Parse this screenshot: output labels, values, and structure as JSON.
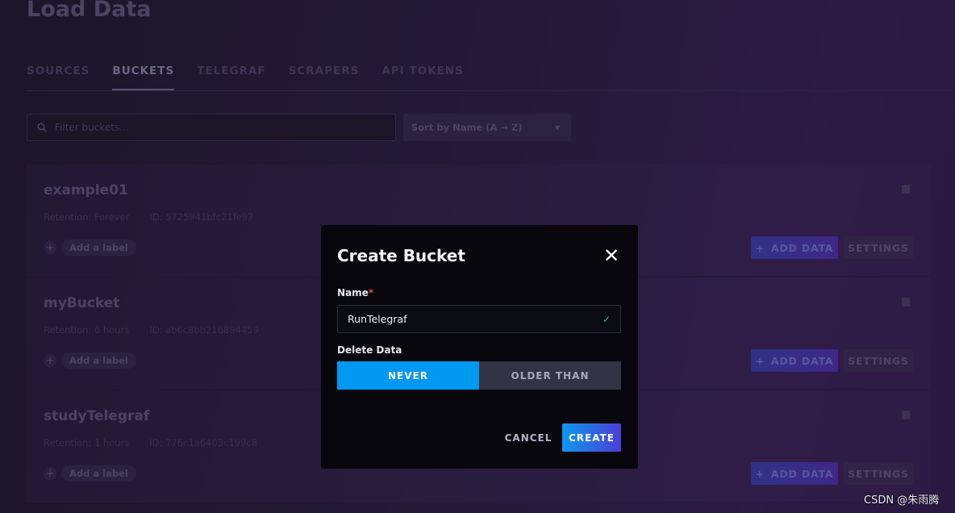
{
  "page": {
    "title": "Load Data"
  },
  "tabs": [
    {
      "label": "SOURCES"
    },
    {
      "label": "BUCKETS",
      "active": true
    },
    {
      "label": "TELEGRAF"
    },
    {
      "label": "SCRAPERS"
    },
    {
      "label": "API TOKENS"
    }
  ],
  "filter": {
    "placeholder": "Filter buckets...",
    "sort": "Sort by Name (A → Z)"
  },
  "buckets": [
    {
      "name": "example01",
      "retention": "Retention: Forever",
      "id": "ID: 5725941bfc21fe97",
      "add_label": "Add a label",
      "add_data": "ADD DATA",
      "settings": "SETTINGS"
    },
    {
      "name": "myBucket",
      "retention": "Retention: 6 hours",
      "id": "ID: ab6c8bb216894459",
      "add_label": "Add a label",
      "add_data": "ADD DATA",
      "settings": "SETTINGS"
    },
    {
      "name": "studyTelegraf",
      "retention": "Retention: 1 hours",
      "id": "ID: 776c1a6403c199c8",
      "add_label": "Add a label",
      "add_data": "ADD DATA",
      "settings": "SETTINGS"
    }
  ],
  "modal": {
    "title": "Create Bucket",
    "name_label": "Name",
    "required_mark": "*",
    "name_value": "RunTelegraf",
    "delete_label": "Delete Data",
    "options": [
      "NEVER",
      "OLDER THAN"
    ],
    "selected": "NEVER",
    "cancel": "CANCEL",
    "create": "CREATE"
  },
  "watermark": "CSDN @朱雨腾"
}
